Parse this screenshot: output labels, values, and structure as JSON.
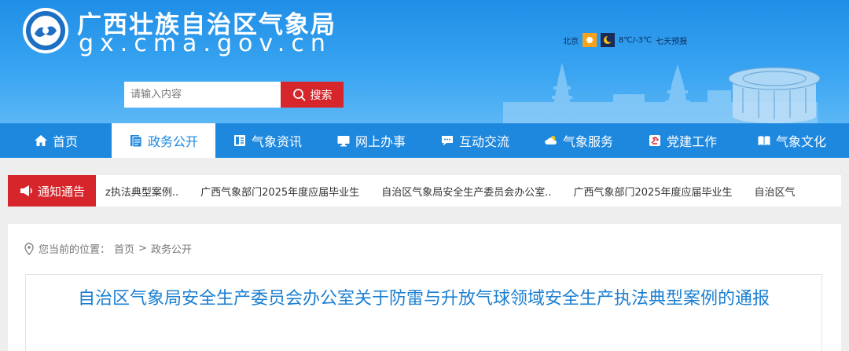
{
  "header": {
    "site_title": "广西壮族自治区气象局",
    "site_domain": "gx.cma.gov.cn",
    "weather": {
      "city": "北京",
      "temp": "8℃/-3℃",
      "forecast_link": "七天预报"
    },
    "search": {
      "placeholder": "请输入内容",
      "button_label": "搜索"
    }
  },
  "nav": {
    "items": [
      {
        "label": "首页",
        "icon": "home-icon"
      },
      {
        "label": "政务公开",
        "icon": "document-icon",
        "active": true
      },
      {
        "label": "气象资讯",
        "icon": "news-icon"
      },
      {
        "label": "网上办事",
        "icon": "monitor-icon"
      },
      {
        "label": "互动交流",
        "icon": "chat-icon"
      },
      {
        "label": "气象服务",
        "icon": "cloud-icon"
      },
      {
        "label": "党建工作",
        "icon": "party-icon"
      },
      {
        "label": "气象文化",
        "icon": "book-icon"
      }
    ]
  },
  "notice": {
    "label": "通知通告",
    "items": [
      "z执法典型案例..",
      "广西气象部门2025年度应届毕业生",
      "自治区气象局安全生产委员会办公室..",
      "广西气象部门2025年度应届毕业生",
      "自治区气"
    ]
  },
  "breadcrumb": {
    "prefix": "您当前的位置：",
    "home": "首页",
    "separator": ">",
    "current": "政务公开"
  },
  "article": {
    "title": "自治区气象局安全生产委员会办公室关于防雷与升放气球领域安全生产执法典型案例的通报"
  },
  "colors": {
    "primary": "#1e88df",
    "accent": "#d7262b",
    "title": "#1b7fd1"
  }
}
